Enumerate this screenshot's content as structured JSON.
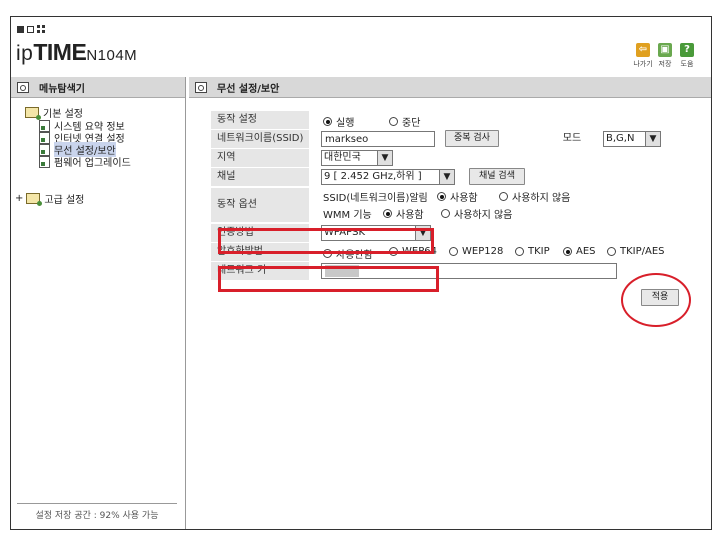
{
  "header": {
    "brand_ip": "ip",
    "brand_time": "TIME",
    "brand_model": "N104M",
    "tools": [
      {
        "icon": "logout-icon",
        "label": "나가기",
        "color": "#e0a020",
        "glyph": "⇦"
      },
      {
        "icon": "save-icon",
        "label": "저장",
        "color": "#6aa84f",
        "glyph": "▣"
      },
      {
        "icon": "help-icon",
        "label": "도움",
        "color": "#4a9a3a",
        "glyph": "?"
      }
    ]
  },
  "sidebar": {
    "title": "메뉴탐색기",
    "basic": "기본 설정",
    "items": [
      "시스템 요약 정보",
      "인터넷 연결 설정",
      "무선 설정/보안",
      "펌웨어 업그레이드"
    ],
    "selected_index": 2,
    "advanced": "고급 설정",
    "advanced_toggle": "+",
    "footer": "설정 저장 공간 : 92% 사용 가능"
  },
  "main": {
    "title": "무선 설정/보안",
    "labels": {
      "operation": "동작 설정",
      "ssid": "네트워크이름(SSID)",
      "region": "지역",
      "channel": "채널",
      "options": "동작 옵션",
      "auth": "인증방법",
      "encryption": "암호화방법",
      "netkey": "네트워크 키",
      "mode": "모드"
    },
    "operation": {
      "on": "실행",
      "off": "중단"
    },
    "ssid_value": "markseo",
    "dup_check_button": "중복 검사",
    "mode_value": "B,G,N",
    "region_value": "대한민국",
    "channel_value": "9 [ 2.452 GHz,하위 ]",
    "channel_search_button": "채널 검색",
    "ssid_alarm_label": "SSID(네트워크이름)알림",
    "wmm_label": "WMM 기능",
    "use": "사용함",
    "not_use": "사용하지 않음",
    "auth_value": "WPAPSK",
    "enc_options": [
      "사용안함",
      "WEP64",
      "WEP128",
      "TKIP",
      "AES",
      "TKIP/AES"
    ],
    "enc_selected": "AES",
    "apply_button": "적용"
  },
  "colors": {
    "annotation_red": "#d81f2a",
    "label_bg": "#e6e6e6",
    "panel_head": "#d8d8d8"
  }
}
